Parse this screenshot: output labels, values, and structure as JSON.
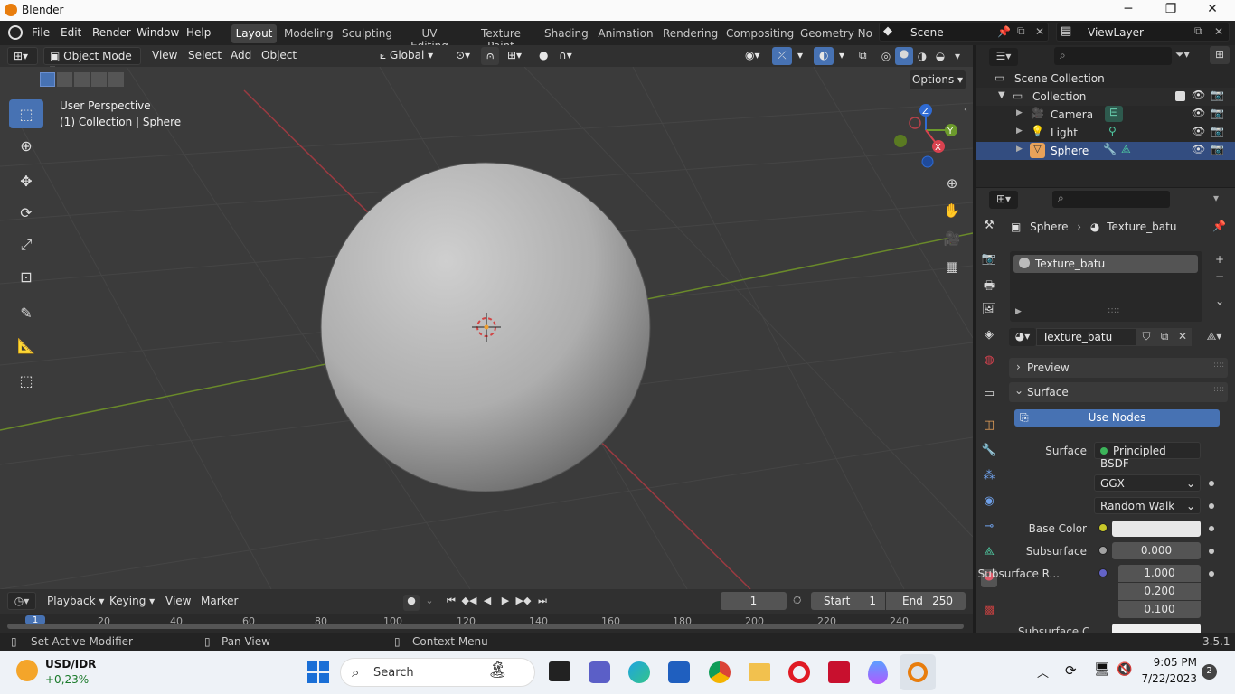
{
  "window": {
    "title": "Blender",
    "minimize": "─",
    "maximize": "❐",
    "close": "✕"
  },
  "menu": {
    "file": "File",
    "edit": "Edit",
    "render": "Render",
    "window": "Window",
    "help": "Help"
  },
  "workspaces": [
    "Layout",
    "Modeling",
    "Sculpting",
    "UV Editing",
    "Texture Paint",
    "Shading",
    "Animation",
    "Rendering",
    "Compositing",
    "Geometry Noc"
  ],
  "active_workspace": "Layout",
  "scene": {
    "name": "Scene",
    "view_layer": "ViewLayer"
  },
  "viewport_header": {
    "mode": "Object Mode",
    "view": "View",
    "select": "Select",
    "add": "Add",
    "object": "Object",
    "transform_orientation": "Global",
    "options": "Options"
  },
  "viewport_overlay": {
    "perspective": "User Perspective",
    "context": "(1) Collection | Sphere"
  },
  "gizmo": {
    "x": "X",
    "y": "Y",
    "z": "Z"
  },
  "outliner": {
    "scene_collection": "Scene Collection",
    "collection": "Collection",
    "items": [
      {
        "name": "Camera",
        "color": "#e8a25a"
      },
      {
        "name": "Light",
        "color": "#e8a25a"
      },
      {
        "name": "Sphere",
        "color": "#e8a25a"
      }
    ]
  },
  "properties": {
    "breadcrumb_object": "Sphere",
    "breadcrumb_material": "Texture_batu",
    "material_slot": "Texture_batu",
    "material_name": "Texture_batu",
    "panel_preview": "Preview",
    "panel_surface": "Surface",
    "use_nodes": "Use Nodes",
    "surface_label": "Surface",
    "surface_value": "Principled BSDF",
    "distribution": "GGX",
    "subsurface_method": "Random Walk",
    "base_color_label": "Base Color",
    "base_color": "#e8e8e8",
    "subsurface_label": "Subsurface",
    "subsurface_value": "0.000",
    "subsurface_radius_label": "Subsurface R...",
    "subsurface_radius": [
      "1.000",
      "0.200",
      "0.100"
    ],
    "subsurface_color_label": "Subsurface C..."
  },
  "timeline": {
    "playback": "Playback",
    "keying": "Keying",
    "view": "View",
    "marker": "Marker",
    "current_frame": "1",
    "start_label": "Start",
    "start": "1",
    "end_label": "End",
    "end": "250",
    "ruler": [
      "1",
      "20",
      "40",
      "60",
      "80",
      "100",
      "120",
      "140",
      "160",
      "180",
      "200",
      "220",
      "240"
    ]
  },
  "statusbar": {
    "left": "Set Active Modifier",
    "middle": "Pan View",
    "right": "Context Menu",
    "version": "3.5.1"
  },
  "taskbar": {
    "stock_name": "USD/IDR",
    "stock_change": "+0,23%",
    "search": "Search",
    "time": "9:05 PM",
    "date": "7/22/2023",
    "notifications": "2"
  },
  "colors": {
    "accent": "#4772b3",
    "axis_x": "#d9424f",
    "axis_y": "#6c9a2c",
    "axis_z": "#2f6bd4"
  }
}
